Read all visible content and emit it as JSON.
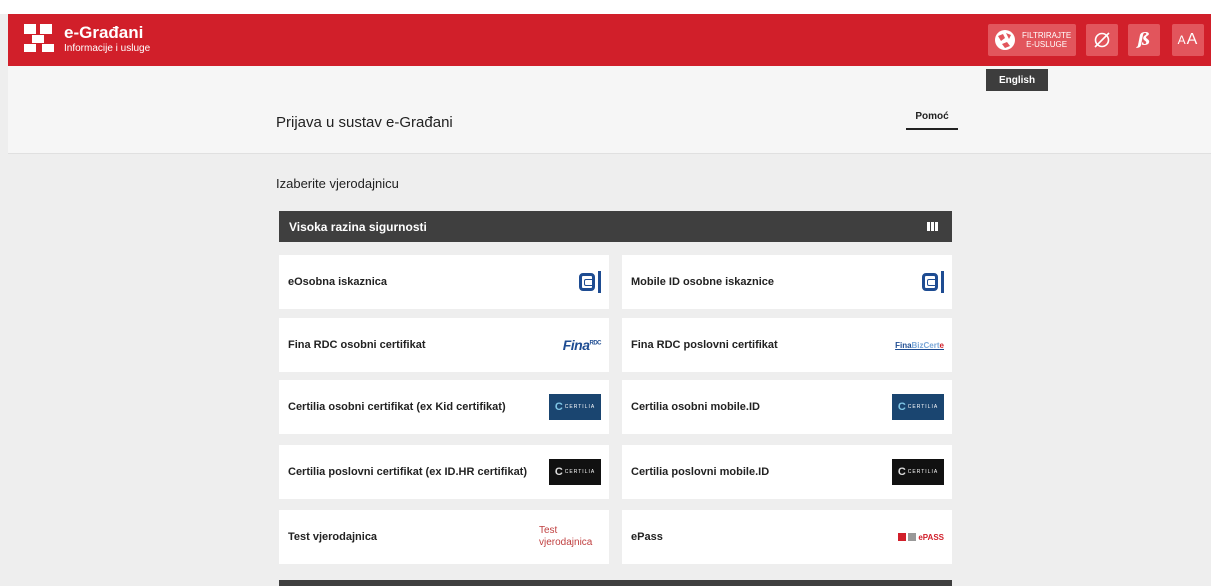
{
  "header": {
    "brand_title": "e-Građani",
    "brand_subtitle": "Informacije i usluge",
    "filter_label": "FILTRIRAJTE\nE-USLUGE",
    "dyslexia_glyph": "ß",
    "font_size_small": "A",
    "font_size_large": "A",
    "icons": [
      "filter-globe-icon",
      "hide-eye-icon"
    ]
  },
  "language": "English",
  "page": {
    "title": "Prijava u sustav e-Građani",
    "help_label": "Pomoć",
    "choose_label": "Izaberite vjerodajnicu"
  },
  "group": {
    "title": "Visoka razina sigurnosti",
    "icon": "bars-icon"
  },
  "credentials": [
    {
      "label": "eOsobna iskaznica",
      "logo": "eoi-logo"
    },
    {
      "label": "Mobile ID osobne iskaznice",
      "logo": "eoi-logo"
    },
    {
      "label": "Fina RDC osobni certifikat",
      "logo": "fina-rdc-logo",
      "logo_text": "Fina",
      "logo_sup": "RDC"
    },
    {
      "label": "Fina RDC poslovni certifikat",
      "logo": "fina-bizcert-logo",
      "logo_text": "Fina",
      "logo_text2": "BizCert",
      "logo_mark": "e"
    },
    {
      "label": "Certilia osobni certifikat (ex Kid certifikat)",
      "logo": "certilia-blue-logo",
      "logo_text": "CERTILIA"
    },
    {
      "label": "Certilia osobni mobile.ID",
      "logo": "certilia-blue-logo",
      "logo_text": "CERTILIA"
    },
    {
      "label": "Certilia poslovni certifikat (ex ID.HR certifikat)",
      "logo": "certilia-dark-logo",
      "logo_text": "CERTILIA"
    },
    {
      "label": "Certilia poslovni mobile.ID",
      "logo": "certilia-dark-logo",
      "logo_text": "CERTILIA"
    },
    {
      "label": "Test vjerodajnica",
      "logo": "broken-image",
      "logo_text": "Test vjerodajnica"
    },
    {
      "label": "ePass",
      "logo": "epass-logo",
      "logo_text": "ePASS"
    }
  ],
  "colors": {
    "brand_red": "#d11f2a",
    "header_dark": "#3f3f3f",
    "logo_blue": "#1e4c92"
  }
}
